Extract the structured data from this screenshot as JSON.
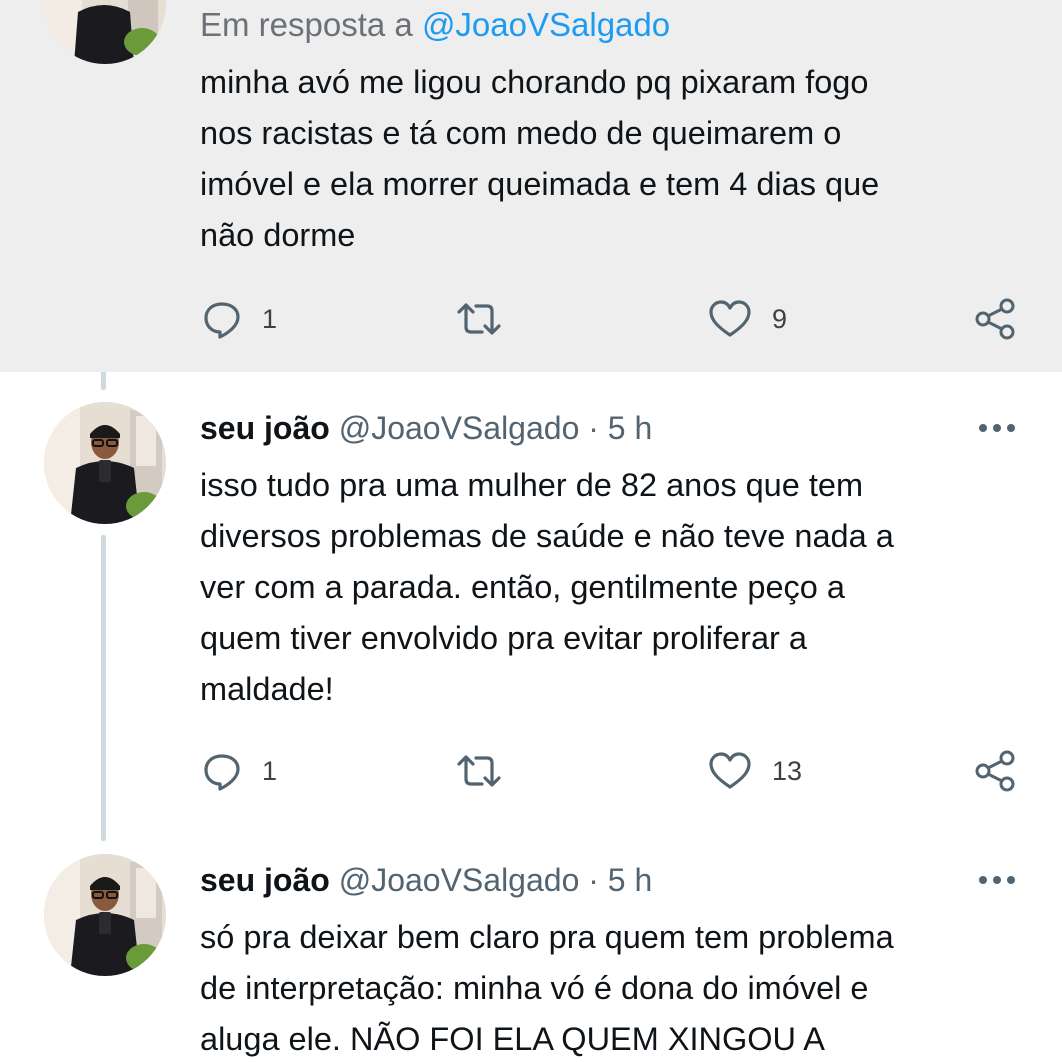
{
  "tweets": [
    {
      "reply_prefix": "Em resposta a ",
      "reply_mention": "@JoaoVSalgado",
      "text": "minha avó me ligou chorando pq pixaram fogo\nnos racistas e tá com medo de queimarem o\nimóvel e ela morrer queimada e tem 4 dias que\nnão dorme",
      "replies": "1",
      "likes": "9"
    },
    {
      "name": "seu joão",
      "handle": "@JoaoVSalgado",
      "separator": "·",
      "time": "5 h",
      "text": "isso tudo pra uma mulher de 82 anos que tem\ndiversos problemas de saúde e não teve nada a\nver com a parada. então, gentilmente peço a\nquem tiver envolvido pra evitar proliferar a\nmaldade!",
      "replies": "1",
      "likes": "13"
    },
    {
      "name": "seu joão",
      "handle": "@JoaoVSalgado",
      "separator": "·",
      "time": "5 h",
      "text": "só pra deixar bem claro pra quem tem problema\nde interpretação: minha vó é dona do imóvel e\naluga ele. NÃO FOI ELA QUEM XINGOU A"
    }
  ],
  "icons": {
    "reply": "reply-icon",
    "retweet": "retweet-icon",
    "like": "heart-icon",
    "share": "share-icon",
    "more": "more-options-icon"
  },
  "colors": {
    "accent": "#1d9bf0",
    "highlight_bg": "#eeeeee",
    "thread_line": "#cfd9de",
    "muted_text": "#536471"
  }
}
